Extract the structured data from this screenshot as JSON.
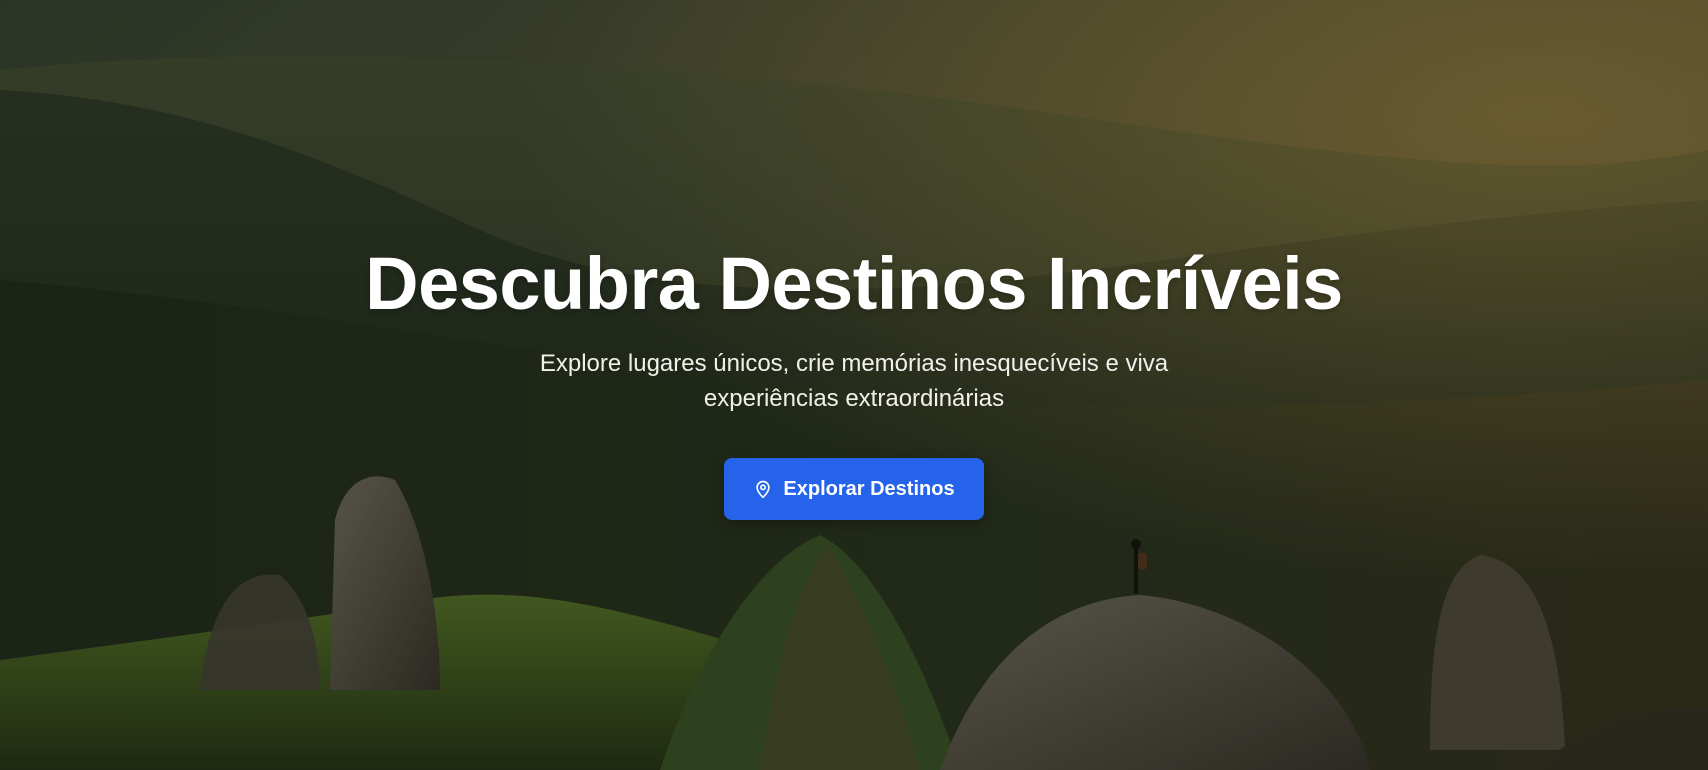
{
  "hero": {
    "title": "Descubra Destinos Incríveis",
    "subtitle": "Explore lugares únicos, crie memórias inesquecíveis e viva experiências extraordinárias",
    "cta_label": "Explorar Destinos",
    "cta_icon": "map-pin-icon",
    "accent_color": "#2563eb"
  }
}
